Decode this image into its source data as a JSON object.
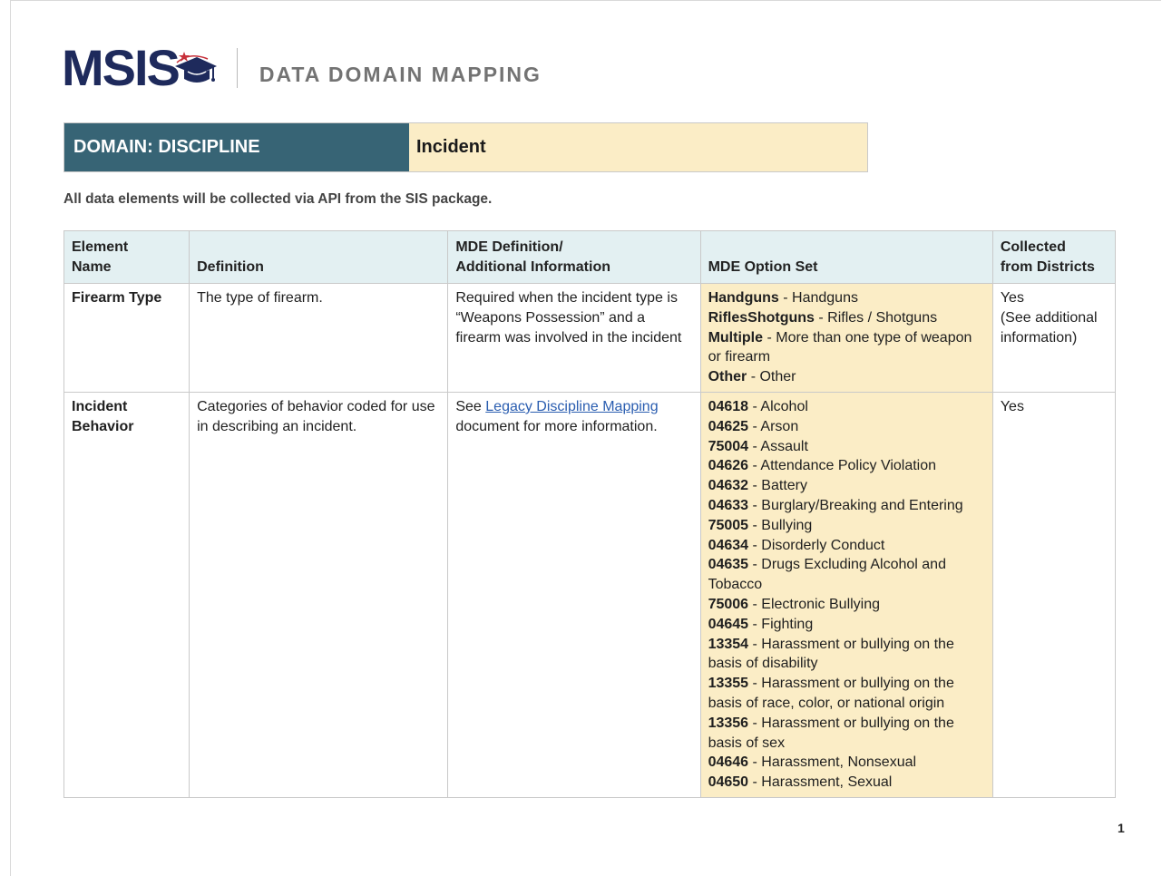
{
  "header": {
    "logo_text": "MSIS",
    "title": "DATA DOMAIN MAPPING"
  },
  "domain_bar": {
    "domain_label": "DOMAIN: DISCIPLINE",
    "subject": "Incident"
  },
  "note": "All data elements will be collected via API from the SIS package.",
  "table": {
    "headers": {
      "element_name_1": "Element",
      "element_name_2": "Name",
      "definition": "Definition",
      "mde_def_1": "MDE Definition/",
      "mde_def_2": "Additional Information",
      "option_set": "MDE Option Set",
      "collected_1": "Collected",
      "collected_2": "from Districts"
    },
    "rows": [
      {
        "element_name": "Firearm Type",
        "definition": "The type of firearm.",
        "mde_definition": "Required when the incident type is “Weapons Possession” and a firearm was involved in the incident",
        "options": [
          {
            "code": "Handguns",
            "desc": " - Handguns"
          },
          {
            "code": "RiflesShotguns",
            "desc": " - Rifles / Shotguns"
          },
          {
            "code": "Multiple",
            "desc": " - More than one type of weapon or firearm"
          },
          {
            "code": "Other",
            "desc": " - Other"
          }
        ],
        "collected_main": "Yes",
        "collected_note": "(See additional information)"
      },
      {
        "element_name": "Incident Behavior",
        "definition": "Categories of behavior coded for use in describing an incident.",
        "mde_prefix": "See ",
        "mde_link": "Legacy Discipline Mapping",
        "mde_suffix": " document for more information.",
        "options": [
          {
            "code": "04618",
            "desc": " - Alcohol"
          },
          {
            "code": "04625",
            "desc": " - Arson"
          },
          {
            "code": "75004",
            "desc": " - Assault"
          },
          {
            "code": "04626",
            "desc": " - Attendance Policy Violation"
          },
          {
            "code": "04632",
            "desc": " - Battery"
          },
          {
            "code": "04633",
            "desc": " - Burglary/Breaking and Entering"
          },
          {
            "code": "75005",
            "desc": " - Bullying"
          },
          {
            "code": "04634",
            "desc": " - Disorderly Conduct"
          },
          {
            "code": "04635",
            "desc": " - Drugs Excluding Alcohol and Tobacco"
          },
          {
            "code": "75006",
            "desc": " - Electronic Bullying"
          },
          {
            "code": "04645",
            "desc": " - Fighting"
          },
          {
            "code": "13354",
            "desc": " - Harassment or bullying on the basis of disability"
          },
          {
            "code": "13355",
            "desc": " - Harassment or bullying on the basis of race, color, or national origin"
          },
          {
            "code": "13356",
            "desc": " - Harassment or bullying on the basis of sex"
          },
          {
            "code": "04646",
            "desc": " - Harassment, Nonsexual"
          },
          {
            "code": "04650",
            "desc": " - Harassment, Sexual"
          }
        ],
        "collected_main": "Yes"
      }
    ]
  },
  "page_number": "1",
  "colors": {
    "domain_fill": "#376475",
    "option_fill": "#fbedc6",
    "header_fill": "#e3f0f2",
    "logo_navy": "#1e2a5c",
    "link": "#2a5db0"
  },
  "icons": [
    "graduation-cap-icon"
  ]
}
